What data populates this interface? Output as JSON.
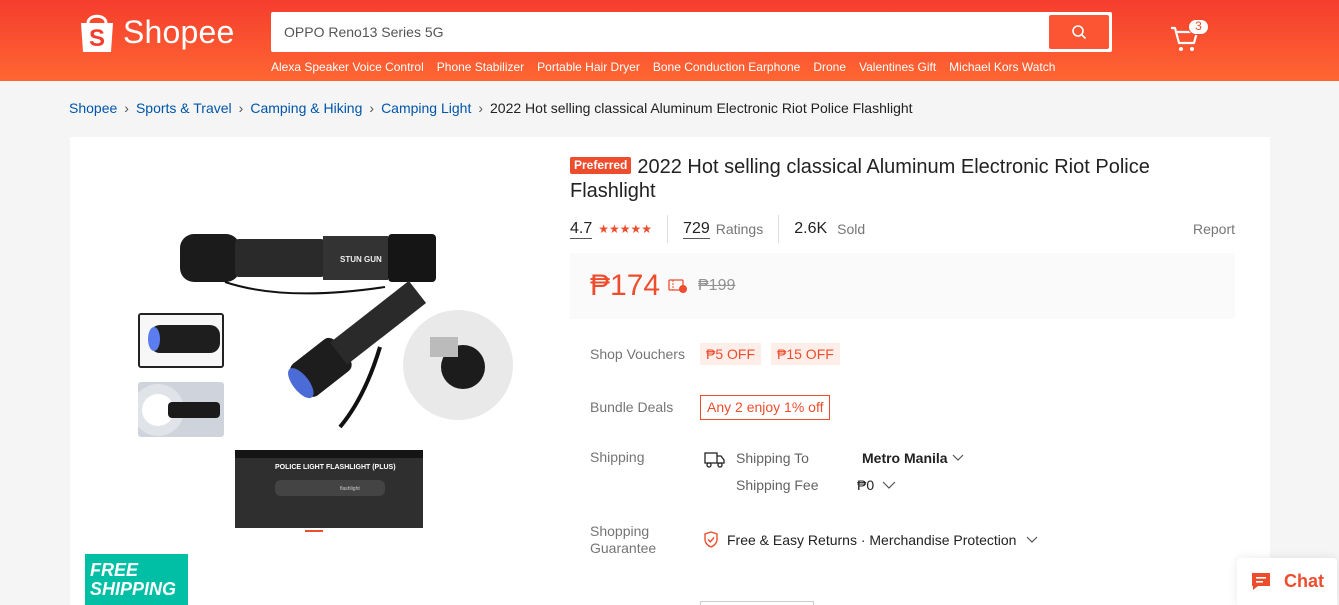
{
  "header": {
    "brand": "Shopee",
    "search_value": "OPPO Reno13 Series 5G",
    "cart_count": "3",
    "suggestions": [
      "Alexa Speaker Voice Control",
      "Phone Stabilizer",
      "Portable Hair Dryer",
      "Bone Conduction Earphone",
      "Drone",
      "Valentines Gift",
      "Michael Kors Watch"
    ]
  },
  "breadcrumb": {
    "items": [
      "Shopee",
      "Sports & Travel",
      "Camping & Hiking",
      "Camping Light"
    ],
    "current": "2022 Hot selling classical Aluminum Electronic Riot Police Flashlight"
  },
  "gallery": {
    "main_label": "STUN GUN",
    "box_label": "POLICE LIGHT FLASHLIGHT (PLUS)",
    "box_sub": "flashlight",
    "free_shipping_line1": "FREE",
    "free_shipping_line2": "SHIPPING"
  },
  "product": {
    "badge": "Preferred",
    "title": "2022 Hot selling classical Aluminum Electronic Riot Police Flashlight",
    "rating": "4.7",
    "rating_stars": 5,
    "ratings_count": "729",
    "ratings_label": "Ratings",
    "sold_count": "2.6K",
    "sold_label": "Sold",
    "report_label": "Report",
    "price": "₱174",
    "price_original": "₱199"
  },
  "details": {
    "vouchers_label": "Shop Vouchers",
    "vouchers": [
      "₱5 OFF",
      "₱15 OFF"
    ],
    "bundle_label": "Bundle Deals",
    "bundle_value": "Any 2 enjoy 1% off",
    "shipping_label": "Shipping",
    "shipping_to_label": "Shipping To",
    "shipping_to_value": "Metro Manila",
    "shipping_fee_label": "Shipping Fee",
    "shipping_fee_value": "₱0",
    "guarantee_label_line1": "Shopping",
    "guarantee_label_line2": "Guarantee",
    "guarantee_value": "Free & Easy Returns · Merchandise Protection"
  },
  "chat": {
    "label": "Chat"
  },
  "colors": {
    "brand": "#ee4d2d",
    "header_top": "#f53d2d",
    "header_bottom": "#ff6633",
    "free_shipping": "#00bfa5"
  }
}
